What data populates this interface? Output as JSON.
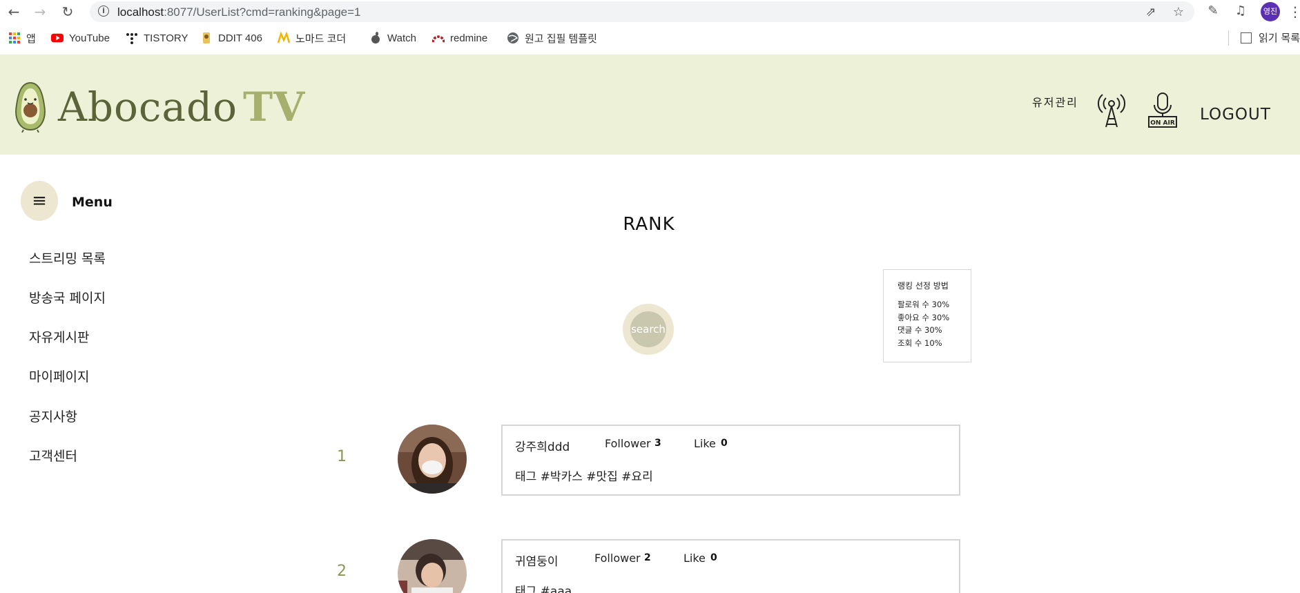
{
  "browser": {
    "url_host": "localhost",
    "url_rest": ":8077/UserList?cmd=ranking&page=1",
    "profile_label": "영진",
    "bookmarks": [
      {
        "label": "앱",
        "icon": "apps-grid-icon"
      },
      {
        "label": "YouTube",
        "icon": "youtube-icon"
      },
      {
        "label": "TISTORY",
        "icon": "tistory-icon"
      },
      {
        "label": "DDIT 406",
        "icon": "ddit-icon"
      },
      {
        "label": "노마드 코더",
        "icon": "nomad-icon"
      },
      {
        "label": "Watch",
        "icon": "apple-icon"
      },
      {
        "label": "redmine",
        "icon": "redmine-icon"
      },
      {
        "label": "원고 집필 템플릿",
        "icon": "globe-icon"
      }
    ],
    "reading_list_label": "읽기 목록"
  },
  "header": {
    "logo_main": "Abocado",
    "logo_tv": "TV",
    "user_manage": "유저관리",
    "logout": "LOGOUT",
    "icons": [
      "broadcast-tower-icon",
      "on-air-mic-icon"
    ],
    "on_air_label": "ON AIR"
  },
  "sidebar": {
    "menu_label": "Menu",
    "items": [
      {
        "label": "스트리밍 목록"
      },
      {
        "label": "방송국 페이지"
      },
      {
        "label": "자유게시판"
      },
      {
        "label": "마이페이지"
      },
      {
        "label": "공지사항"
      },
      {
        "label": "고객센터"
      }
    ]
  },
  "main": {
    "title": "RANK",
    "search_label": "search",
    "rank_info": {
      "title": "랭킹 선정 방법",
      "lines": [
        "팔로워 수 30%",
        "좋아요 수 30%",
        "댓글 수 30%",
        "조회 수 10%"
      ]
    },
    "follower_label": "Follower",
    "like_label": "Like",
    "rankings": [
      {
        "rank": "1",
        "name": "강주희ddd",
        "followers": "3",
        "likes": "0",
        "tags": "태그 #박카스 #맛집 #요리"
      },
      {
        "rank": "2",
        "name": "귀염둥이",
        "followers": "2",
        "likes": "0",
        "tags": "태그 #aaa"
      }
    ]
  },
  "colors": {
    "header_bg": "#edf1d7",
    "accent_olive": "#8a9652",
    "circle_beige": "#ede6d0"
  }
}
